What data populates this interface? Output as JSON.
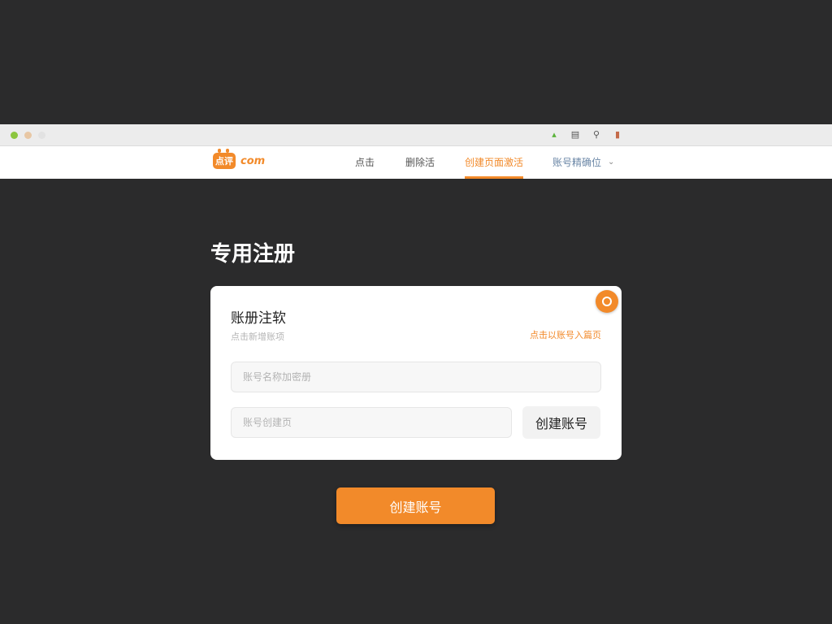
{
  "browser": {
    "icons": [
      "signal-icon",
      "printer-icon",
      "search-icon",
      "record-icon"
    ]
  },
  "nav": {
    "logo_mark": "点评",
    "logo_text": "com",
    "items": [
      {
        "label": "点击"
      },
      {
        "label": "删除活"
      },
      {
        "label": "创建页面激活"
      },
      {
        "label": "账号精确位"
      }
    ]
  },
  "page": {
    "title": "专用注册"
  },
  "card": {
    "title": "账册注软",
    "subtitle": "点击新增账项",
    "link": "点击以账号入篇页",
    "field1_placeholder": "账号名称加密册",
    "field2_placeholder": "账号创建页",
    "inline_button": "创建账号"
  },
  "submit": {
    "label": "创建账号"
  },
  "colors": {
    "accent": "#f28a2a",
    "background": "#2b2b2c"
  }
}
